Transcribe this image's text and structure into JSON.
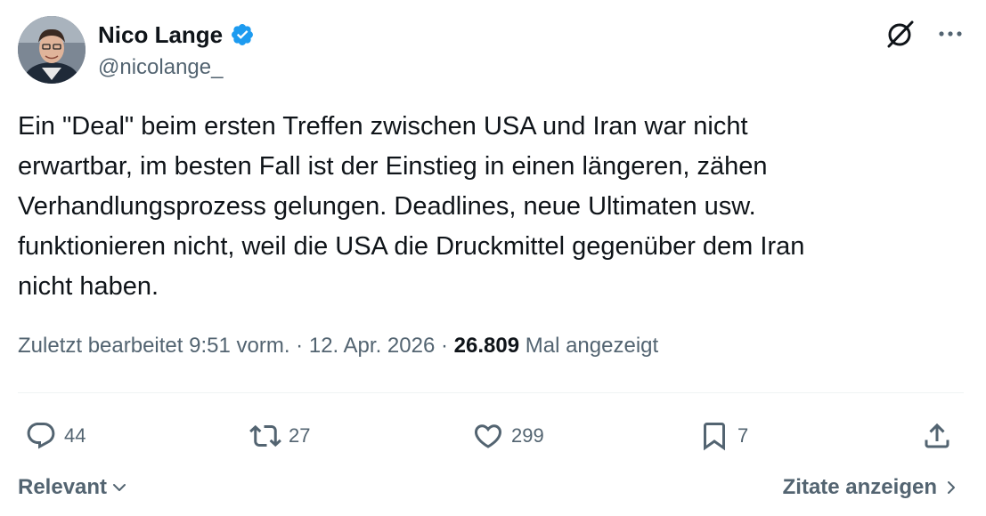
{
  "author": {
    "display_name": "Nico Lange",
    "handle": "@nicolange_",
    "verified": true,
    "avatar_icon": "user-avatar"
  },
  "tweet": {
    "lines": [
      "Ein \"Deal\" beim ersten Treffen zwischen USA und Iran war nicht",
      "erwartbar, im besten Fall ist der Einstieg in einen längeren, zähen",
      "Verhandlungsprozess gelungen. Deadlines, neue Ultimaten usw.",
      "funktionieren nicht, weil die USA die Druckmittel gegenüber dem Iran",
      "nicht haben."
    ]
  },
  "meta": {
    "edited_label": "Zuletzt bearbeitet",
    "time": "9:51 vorm.",
    "separator": "·",
    "date": "12. Apr. 2026",
    "views_count": "26.809",
    "views_label": "Mal angezeigt"
  },
  "actions": {
    "reply_count": "44",
    "repost_count": "27",
    "like_count": "299",
    "bookmark_count": "7"
  },
  "footer": {
    "sort_label": "Relevant",
    "quotes_label": "Zitate anzeigen"
  },
  "colors": {
    "text": "#0f1419",
    "secondary": "#536471",
    "verified": "#1d9bf0",
    "divider": "#eff3f4"
  }
}
